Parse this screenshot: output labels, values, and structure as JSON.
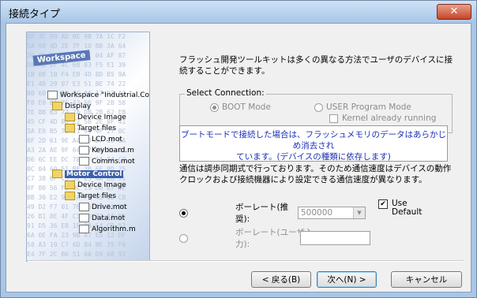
{
  "window": {
    "title": "接続タイプ",
    "close_glyph": "✕"
  },
  "wizard_image": {
    "hex_lines": [
      "8F 3C 59 AD 0E 9B 7A 1C F2",
      "5A 98 4D 2E 7F 10 BB 3A 64",
      "20 00 6D 1A 5E 9C 04 AF 87",
      "D8 A0 2F 4C 6B 83 F5 E1 39",
      "1B 00 10 F4 EB 4D BD B5 9A",
      "E1 4B 29 07 E3 51 BE 74 22",
      "00 60 FD 59 0C 8A 17 D3 A2",
      "F8 E0 B1 7C 43 06 9F 2B 58",
      "7E 8B B3 77 2A DB 2B 62 EB",
      "45 CF 4D 8D E2 5B 2E 0F 41",
      "3A E0 B5 7B C1 96 4F 27 8C",
      "0F 2D 61 9E A4 33 D7 18 BA",
      "A3 2A AE 9F 64 17 E9 5C 02",
      "D6 6C EE DC 78 BF 1A 84 C3",
      "0C 04 60 51 BF 3B 6E 9D 25",
      "C7 38 6F C5 52 E3 4A B8 71",
      "0F 80 56 F2 8C 19 D0 67 3E",
      "BB 30 E2 97 2A F6 45 0D CB",
      "49 D2 F7 01 78 E5 AB 31 9C",
      "26 B1 8E 4F C3 5D 72 AA 06",
      "91 D5 36 EB 1F 80 64 C9 57",
      "6A 0E FA 23 9B 47 E8 12 DF",
      "58 A3 19 C7 6D 84 BE 35 F0",
      "E4 7F 2C B6 51 0A D9 68 93"
    ],
    "workspace_label": "Workspace",
    "tree": [
      "Workspace \"Industrial.Co",
      "Display",
      "Device Image",
      "Target files",
      "LCD.mot",
      "Keyboard.m",
      "Comms.mot",
      "Motor Control",
      "Device Image",
      "Target files",
      "Drive.mot",
      "Data.mot",
      "Algorithm.m"
    ]
  },
  "description": "フラッシュ開発ツールキットは多くの異なる方法でユーザのデバイスに接続することができます。",
  "select_connection": {
    "legend": "Select Connection:",
    "boot_mode": "BOOT Mode",
    "user_program_mode": "USER Program Mode",
    "boot_selected": true
  },
  "kernel_already_running": "Kernel already running",
  "notice_line1": "ブートモードで接続した場合は、フラッシュメモリのデータはあらかじめ消去され",
  "notice_line2": "ています。(デバイスの種類に依存します)",
  "bitrate_note": "通信は調歩同期式で行っております。そのため通信速度はデバイスの動作クロックおよび接続機器により設定できる通信速度が異なります。",
  "baud_recommended": {
    "label": "ボーレート(推奨):",
    "value": "500000",
    "selected": true
  },
  "baud_user": {
    "label": "ボーレート(ユーザ入力):",
    "value": "",
    "selected": false
  },
  "use_default": {
    "line1": "Use",
    "line2": "Default",
    "checked": true,
    "check_glyph": "✔"
  },
  "buttons": {
    "back": "< 戻る(B)",
    "next": "次へ(N) >",
    "cancel": "キャンセル"
  }
}
